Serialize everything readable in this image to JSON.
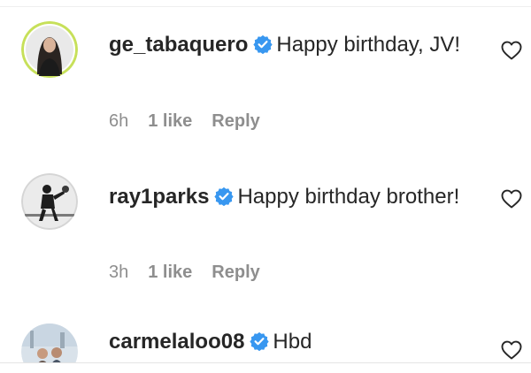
{
  "comments": [
    {
      "username": "ge_tabaquero",
      "verified": true,
      "text": "Happy birthday, JV!",
      "time": "6h",
      "likes": "1 like",
      "reply": "Reply",
      "avatar_icon": "profile-photo-woman"
    },
    {
      "username": "ray1parks",
      "verified": true,
      "text": "Happy birthday brother!",
      "time": "3h",
      "likes": "1 like",
      "reply": "Reply",
      "avatar_icon": "profile-photo-player"
    },
    {
      "username": "carmelaloo08",
      "verified": true,
      "text": "Hbd",
      "avatar_icon": "profile-photo-group"
    }
  ],
  "colors": {
    "verified_badge": "#3897f0",
    "avatar_ring": "#c7e05a",
    "meta_text": "#8e8e8e"
  }
}
